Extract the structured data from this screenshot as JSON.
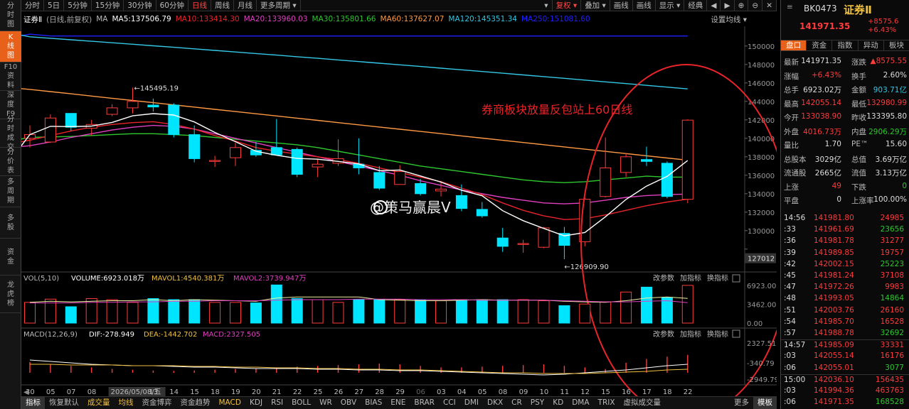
{
  "topbar": {
    "tabs": [
      "分时",
      "5日",
      "5分钟",
      "15分钟",
      "30分钟",
      "60分钟",
      "日线",
      "周线",
      "月线",
      "更多周期 ▾"
    ],
    "right": [
      "▾",
      "复权 ▾",
      "叠加 ▾",
      "画线",
      "画线",
      "显示 ▾",
      "经典"
    ],
    "icons": [
      "◀",
      "▶",
      "⊕",
      "⊖",
      "✕"
    ]
  },
  "leftnav": [
    "分时图",
    "K线图",
    "F10资料",
    "深度F9",
    "分时成交",
    "分价表",
    "多周期",
    "多股",
    "资金",
    "龙虎榜"
  ],
  "info": {
    "name": "证券Ⅱ",
    "mode": "(日线,前复权)",
    "ma": "MA",
    "ma5": "MA5:137506.79",
    "ma10": "MA10:133414.30",
    "ma20": "MA20:133960.03",
    "ma30": "MA30:135801.66",
    "ma60": "MA60:137627.07",
    "ma120": "MA120:145351.34",
    "ma250": "MA250:151081.60",
    "settings": "设置均线 ▾"
  },
  "annotation": "券商板块放量反包站上60日线",
  "watermark": "@策马赢晨V",
  "price_labels": {
    "high": "145495.19",
    "low": "126909.90",
    "current": "127012"
  },
  "yaxis": [
    "150000",
    "148000",
    "146000",
    "144000",
    "142000",
    "140000",
    "138000",
    "136000",
    "134000",
    "132000",
    "130000",
    "128000"
  ],
  "vol": {
    "title": "VOL(5,10)",
    "volume": "VOLUME:6923.018万",
    "mavol1": "MAVOL1:4540.381万",
    "mavol2": "MAVOL2:3739.947万",
    "btns": [
      "改参数",
      "加指标",
      "换指标"
    ],
    "axis": [
      "6923.00",
      "3462.00",
      "0.00"
    ]
  },
  "macd": {
    "title": "MACD(12,26,9)",
    "dif": "DIF:-278.949",
    "dea": "DEA:-1442.702",
    "macd": "MACD:2327.505",
    "btns": [
      "改参数",
      "加指标",
      "换指标"
    ],
    "axis": [
      "2327.51",
      "-340.79",
      "-2949.79"
    ]
  },
  "dates": [
    "30",
    "05",
    "07",
    "08",
    "2026/05/08/五",
    "13",
    "14",
    "15",
    "18",
    "19",
    "20",
    "21",
    "22",
    "25",
    "26",
    "27",
    "28",
    "29",
    "06",
    "03",
    "04",
    "05",
    "08",
    "09",
    "10",
    "11",
    "12",
    "15",
    "16",
    "17",
    "18",
    "22"
  ],
  "bottom": [
    "指标",
    "恢复默认",
    "成交量",
    "均线",
    "资金博弈",
    "资金趋势",
    "MACD",
    "KDJ",
    "RSI",
    "BOLL",
    "WR",
    "OBV",
    "BIAS",
    "ENE",
    "BRAR",
    "CCI",
    "DMI",
    "DKX",
    "CR",
    "PSY",
    "KD",
    "DMA",
    "TRIX",
    "虚拟成交量",
    "更多",
    "模板"
  ],
  "stock": {
    "code": "BK0473",
    "name": "证券Ⅱ",
    "price": "141971.35",
    "change": "+8575.6",
    "pct": "+6.43%"
  },
  "rtabs": [
    "盘口",
    "资金",
    "指数",
    "异动",
    "板块"
  ],
  "quote": [
    [
      "最新",
      "141971.35",
      "涨跌",
      "▲8575.55"
    ],
    [
      "涨幅",
      "+6.43%",
      "换手",
      "2.60%"
    ],
    [
      "总手",
      "6923.02万",
      "金额",
      "903.71亿"
    ],
    [
      "最高",
      "142055.14",
      "最低",
      "132980.99"
    ],
    [
      "今开",
      "133038.90",
      "昨收",
      "133395.80"
    ],
    [
      "外盘",
      "4016.73万",
      "内盘",
      "2906.29万"
    ],
    [
      "量比",
      "1.70",
      "PE™",
      "15.60"
    ],
    [
      "总股本",
      "3029亿",
      "总值",
      "3.69万亿"
    ],
    [
      "流通股",
      "2665亿",
      "流值",
      "3.13万亿"
    ],
    [
      "上涨",
      "49",
      "下跌",
      "0"
    ],
    [
      "平盘",
      "0",
      "上涨率",
      "100.00%"
    ]
  ],
  "ticks": [
    [
      "14:56",
      "141981.80",
      "24985"
    ],
    [
      ":33",
      "141961.69",
      "23656"
    ],
    [
      ":36",
      "141981.78",
      "31277"
    ],
    [
      ":39",
      "141989.85",
      "19757"
    ],
    [
      ":42",
      "142002.15",
      "25223"
    ],
    [
      ":45",
      "141981.24",
      "37108"
    ],
    [
      ":47",
      "141972.26",
      "9983"
    ],
    [
      ":48",
      "141993.05",
      "14864"
    ],
    [
      ":51",
      "142003.76",
      "26160"
    ],
    [
      ":54",
      "141985.70",
      "16528"
    ],
    [
      ":57",
      "141988.78",
      "32692"
    ],
    [
      "14:57",
      "141985.09",
      "33331"
    ],
    [
      ":03",
      "142055.14",
      "16176"
    ],
    [
      ":06",
      "142055.01",
      "3077"
    ],
    [
      "15:00",
      "142036.10",
      "156435"
    ],
    [
      ":03",
      "141994.36",
      "463763"
    ],
    [
      ":06",
      "141971.35",
      "168528"
    ]
  ],
  "colors": {
    "up": "#ff3b3b",
    "down": "#00e5ff",
    "ma5": "#ffffff",
    "ma10": "#e8242a",
    "ma20": "#e040c0",
    "ma30": "#2ec82e",
    "ma60": "#ff9944",
    "ma120": "#33c8e6",
    "ma250": "#2020ff",
    "accent": "#e8611a"
  },
  "candles": [
    {
      "o": 140000,
      "h": 141400,
      "l": 139000,
      "c": 140400
    },
    {
      "o": 139600,
      "h": 142600,
      "l": 139500,
      "c": 142200
    },
    {
      "o": 142700,
      "h": 142700,
      "l": 140800,
      "c": 141200
    },
    {
      "o": 141100,
      "h": 142000,
      "l": 140300,
      "c": 141500
    },
    {
      "o": 142600,
      "h": 143700,
      "l": 142400,
      "c": 143300
    },
    {
      "o": 143300,
      "h": 145495.19,
      "l": 142700,
      "c": 144000
    },
    {
      "o": 143600,
      "h": 144300,
      "l": 142900,
      "c": 143400
    },
    {
      "o": 143600,
      "h": 143800,
      "l": 140100,
      "c": 140400
    },
    {
      "o": 140400,
      "h": 141400,
      "l": 137400,
      "c": 137800
    },
    {
      "o": 137500,
      "h": 138100,
      "l": 136900,
      "c": 137600
    },
    {
      "o": 137900,
      "h": 139500,
      "l": 137000,
      "c": 139000
    },
    {
      "o": 138700,
      "h": 139600,
      "l": 138000,
      "c": 138200
    },
    {
      "o": 139000,
      "h": 142100,
      "l": 138500,
      "c": 138200
    },
    {
      "o": 138800,
      "h": 139000,
      "l": 135800,
      "c": 136100
    },
    {
      "o": 136900,
      "h": 137800,
      "l": 135800,
      "c": 137200
    },
    {
      "o": 137300,
      "h": 139900,
      "l": 137000,
      "c": 137800
    },
    {
      "o": 137200,
      "h": 140000,
      "l": 136100,
      "c": 136800
    },
    {
      "o": 136300,
      "h": 137000,
      "l": 134400,
      "c": 134600
    },
    {
      "o": 135000,
      "h": 137100,
      "l": 135000,
      "c": 136400
    },
    {
      "o": 135100,
      "h": 135600,
      "l": 133800,
      "c": 134000
    },
    {
      "o": 134300,
      "h": 135400,
      "l": 133700,
      "c": 134500
    },
    {
      "o": 133800,
      "h": 135000,
      "l": 132100,
      "c": 132400
    },
    {
      "o": 132300,
      "h": 133100,
      "l": 131400,
      "c": 131600
    },
    {
      "o": 129200,
      "h": 130300,
      "l": 127700,
      "c": 128300
    },
    {
      "o": 128500,
      "h": 129000,
      "l": 127600,
      "c": 128600
    },
    {
      "o": 128200,
      "h": 130400,
      "l": 128100,
      "c": 130300
    },
    {
      "o": 129700,
      "h": 130400,
      "l": 126909.9,
      "c": 128400
    },
    {
      "o": 128800,
      "h": 133600,
      "l": 128300,
      "c": 133400
    },
    {
      "o": 133700,
      "h": 140100,
      "l": 133600,
      "c": 136800
    },
    {
      "o": 136300,
      "h": 138400,
      "l": 135800,
      "c": 138000
    },
    {
      "o": 137700,
      "h": 139100,
      "l": 137000,
      "c": 137500
    },
    {
      "o": 137300,
      "h": 137500,
      "l": 133500,
      "c": 133700
    },
    {
      "o": 133395.8,
      "h": 142055.14,
      "l": 132980.99,
      "c": 141971.35
    }
  ],
  "volumes": [
    3800,
    4400,
    3000,
    4500,
    4300,
    3800,
    4500,
    4300,
    4300,
    3800,
    3800,
    3700,
    7000,
    4500,
    4300,
    3800,
    4300,
    4300,
    4300,
    4300,
    4100,
    4300,
    4300,
    4300,
    4300,
    4100,
    3200,
    3500,
    3900,
    5700,
    6600,
    4700,
    6923
  ],
  "mavol1": [
    3800,
    4000,
    3900,
    4000,
    4100,
    4100,
    4300,
    4100,
    4300,
    4200,
    4100,
    4000,
    4600,
    4800,
    4800,
    4800,
    4800,
    4300,
    4200,
    4100,
    4100,
    4200,
    4300,
    4200,
    4200,
    4200,
    4000,
    3900,
    3800,
    4100,
    4600,
    4800,
    4540
  ],
  "mavol2": [
    3700,
    3700,
    3700,
    3800,
    3800,
    3900,
    3900,
    4000,
    4000,
    4100,
    4100,
    4100,
    4200,
    4300,
    4300,
    4300,
    4400,
    4400,
    4400,
    4300,
    4300,
    4300,
    4200,
    4200,
    4200,
    4200,
    4100,
    4000,
    3900,
    3900,
    4000,
    4100,
    3740
  ],
  "macd_bars": [
    1400,
    1100,
    900,
    700,
    500,
    400,
    300,
    250,
    300,
    400,
    500,
    600,
    700,
    800,
    900,
    1000,
    1100,
    1200,
    1100,
    900,
    700,
    700,
    800,
    900,
    1000,
    1100,
    900,
    700,
    500,
    1300,
    1800,
    2100,
    2327
  ]
}
